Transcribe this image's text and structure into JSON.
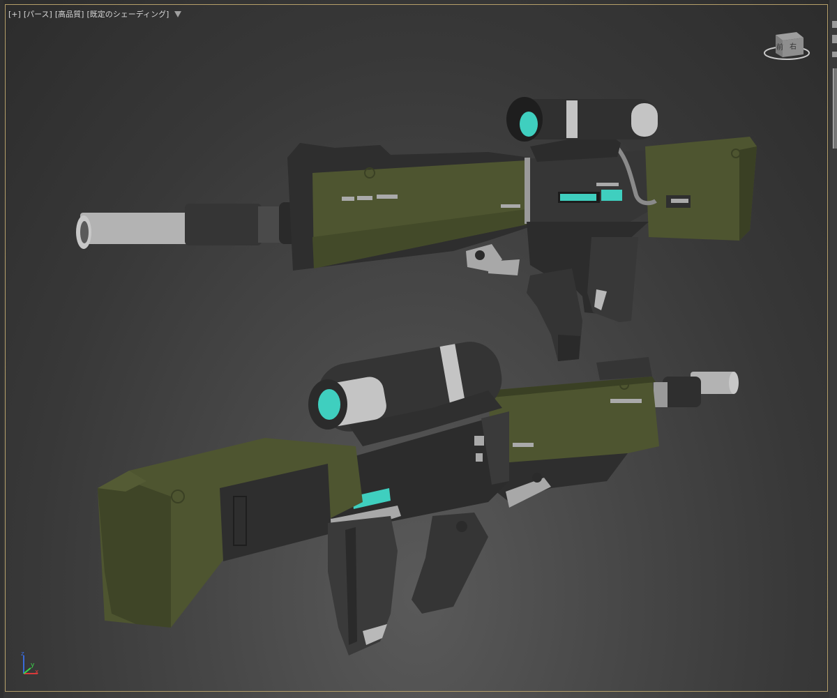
{
  "viewport": {
    "label": {
      "plus": "[+]",
      "view": "[パース]",
      "quality": "[高品質]",
      "shading": "[既定のシェーディング]"
    },
    "filter_icon": "filter-icon",
    "viewcube": {
      "face_front": "前",
      "face_right": "右"
    },
    "axis_labels": {
      "z": "z",
      "x": "x",
      "y": "y"
    }
  },
  "colors": {
    "olive": "#4e5530",
    "olive_dark": "#3a4024",
    "gray_dark": "#2f2f2f",
    "gray_mid": "#3c3c3c",
    "gray_light": "#b9b9b9",
    "teal": "#3fcfbf",
    "border": "#b6a06a"
  }
}
